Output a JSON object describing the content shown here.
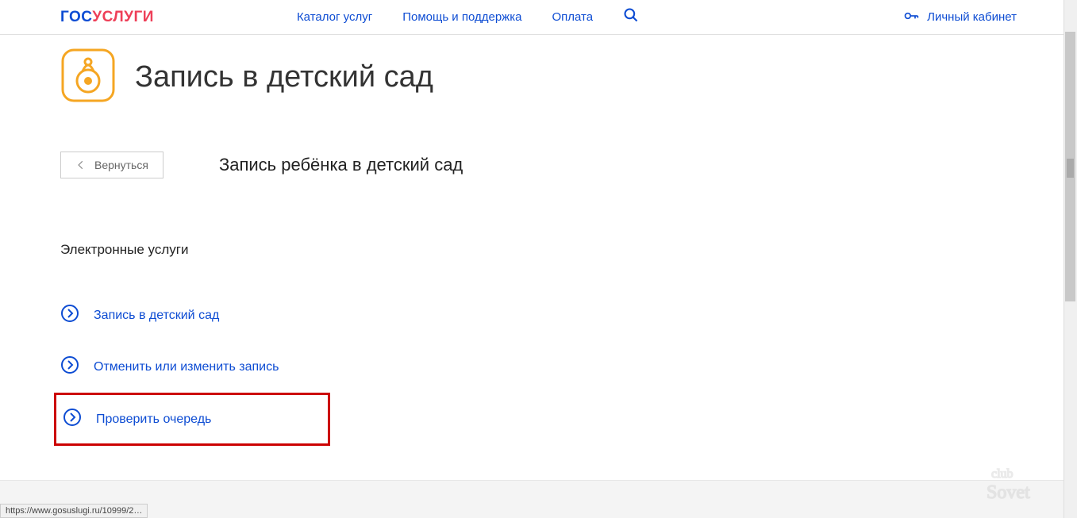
{
  "header": {
    "logo_gos": "ГОС",
    "logo_uslugi": "УСЛУГИ",
    "nav": {
      "catalog": "Каталог услуг",
      "help": "Помощь и поддержка",
      "payment": "Оплата"
    },
    "cabinet": "Личный кабинет"
  },
  "main": {
    "title": "Запись в детский сад",
    "back_label": "Вернуться",
    "subtitle": "Запись ребёнка в детский сад",
    "section": "Электронные услуги",
    "services": {
      "enroll": "Запись в детский сад",
      "cancel": "Отменить или изменить запись",
      "check": "Проверить очередь"
    }
  },
  "status": "https://www.gosuslugi.ru/10999/2…"
}
